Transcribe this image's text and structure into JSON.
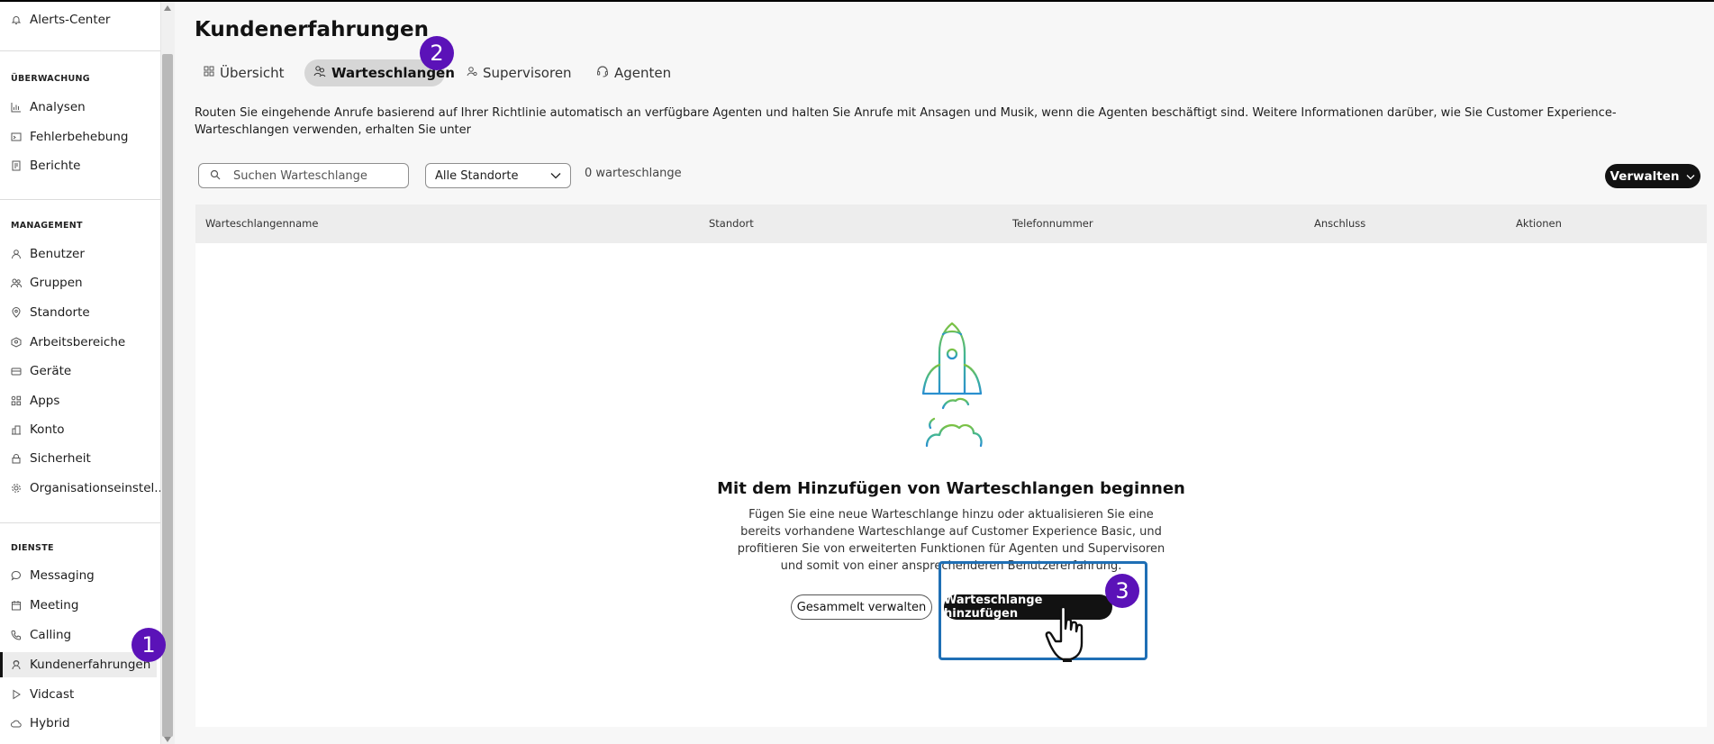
{
  "sidebar": {
    "top_item": {
      "label": "Alerts-Center",
      "icon": "bell-icon"
    },
    "sections": [
      {
        "title": "ÜBERWACHUNG",
        "items": [
          {
            "label": "Analysen",
            "icon": "chart-icon"
          },
          {
            "label": "Fehlerbehebung",
            "icon": "troubleshoot-icon"
          },
          {
            "label": "Berichte",
            "icon": "report-icon"
          }
        ]
      },
      {
        "title": "MANAGEMENT",
        "items": [
          {
            "label": "Benutzer",
            "icon": "user-icon"
          },
          {
            "label": "Gruppen",
            "icon": "group-icon"
          },
          {
            "label": "Standorte",
            "icon": "location-icon"
          },
          {
            "label": "Arbeitsbereiche",
            "icon": "workspace-icon"
          },
          {
            "label": "Geräte",
            "icon": "device-icon"
          },
          {
            "label": "Apps",
            "icon": "apps-icon"
          },
          {
            "label": "Konto",
            "icon": "account-icon"
          },
          {
            "label": "Sicherheit",
            "icon": "lock-icon"
          },
          {
            "label": "Organisationseinstel...",
            "icon": "gear-icon"
          }
        ]
      },
      {
        "title": "DIENSTE",
        "items": [
          {
            "label": "Messaging",
            "icon": "message-icon"
          },
          {
            "label": "Meeting",
            "icon": "calendar-icon"
          },
          {
            "label": "Calling",
            "icon": "phone-icon"
          },
          {
            "label": "Kundenerfahrungen",
            "icon": "customer-icon",
            "active": true
          },
          {
            "label": "Vidcast",
            "icon": "play-icon"
          },
          {
            "label": "Hybrid",
            "icon": "cloud-icon"
          }
        ]
      }
    ]
  },
  "header": {
    "title": "Kundenerfahrungen"
  },
  "tabs": [
    {
      "label": "Übersicht",
      "icon": "grid-icon"
    },
    {
      "label": "Warteschlangen",
      "icon": "queue-icon",
      "active": true
    },
    {
      "label": "Supervisoren",
      "icon": "supervisor-icon"
    },
    {
      "label": "Agenten",
      "icon": "headset-icon"
    }
  ],
  "intro_text": "Routen Sie eingehende Anrufe basierend auf Ihrer Richtlinie automatisch an verfügbare Agenten und halten Sie Anrufe mit Ansagen und Musik, wenn die Agenten beschäftigt sind. Weitere Informationen darüber, wie Sie Customer Experience-Warteschlangen verwenden, erhalten Sie unter",
  "toolbar": {
    "search_placeholder": "Suchen Warteschlange",
    "location_filter": "Alle Standorte",
    "count_text": "0 warteschlange",
    "manage_label": "Verwalten"
  },
  "table": {
    "columns": [
      "Warteschlangenname",
      "Standort",
      "Telefonnummer",
      "Anschluss",
      "Aktionen"
    ]
  },
  "empty_state": {
    "title": "Mit dem Hinzufügen von Warteschlangen beginnen",
    "description": "Fügen Sie eine neue Warteschlange hinzu oder aktualisieren Sie eine bereits vorhandene Warteschlange auf Customer Experience Basic, und profitieren Sie von erweiterten Funktionen für Agenten und Supervisoren und somit von einer ansprechenderen Benutzererfahrung.",
    "bulk_manage_label": "Gesammelt verwalten",
    "add_queue_label": "Warteschlange hinzufügen"
  },
  "annotations": {
    "badge_1": "1",
    "badge_2": "2",
    "badge_3": "3",
    "badge_color": "#5b12b8",
    "highlight_color": "#1f6fb5"
  }
}
